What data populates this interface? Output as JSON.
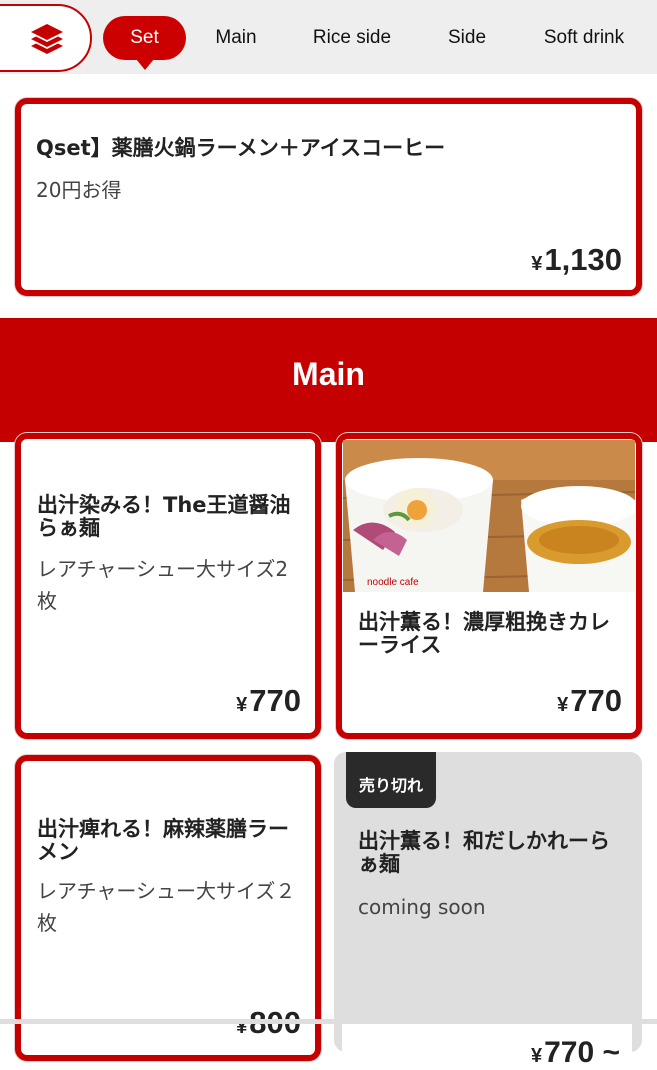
{
  "nav": {
    "menu_icon": "layers-icon",
    "tabs": [
      {
        "label": "Set",
        "active": true
      },
      {
        "label": "Main",
        "active": false
      },
      {
        "label": "Rice side",
        "active": false
      },
      {
        "label": "Side",
        "active": false
      },
      {
        "label": "Soft drink",
        "active": false
      }
    ]
  },
  "set_items": [
    {
      "title": "Qset】薬膳火鍋ラーメン＋アイスコーヒー",
      "description": "20円お得",
      "currency": "¥",
      "price": "1,130"
    }
  ],
  "main_section": {
    "title": "Main",
    "items": [
      {
        "title": "出汁染みる！The王道醤油らぁ麺",
        "description": "レアチャーシュー大サイズ2枚",
        "currency": "¥",
        "price": "770"
      },
      {
        "title": "出汁薫る！濃厚粗挽きカレーライス",
        "currency": "¥",
        "price": "770",
        "image": "curry-rice-photo"
      },
      {
        "title": "出汁痺れる！麻辣薬膳ラーメン",
        "description": "レアチャーシュー大サイズ２枚",
        "currency": "¥",
        "price": "800"
      },
      {
        "title": "出汁薫る！和だしかれーらぁ麺",
        "description": "coming soon",
        "badge": "売り切れ",
        "currency": "¥",
        "price": "770 ~",
        "sold_out": true
      }
    ]
  },
  "colors": {
    "brand_red": "#c40000",
    "nav_background": "#eeeeee",
    "sold_out_gray": "#dedede"
  }
}
